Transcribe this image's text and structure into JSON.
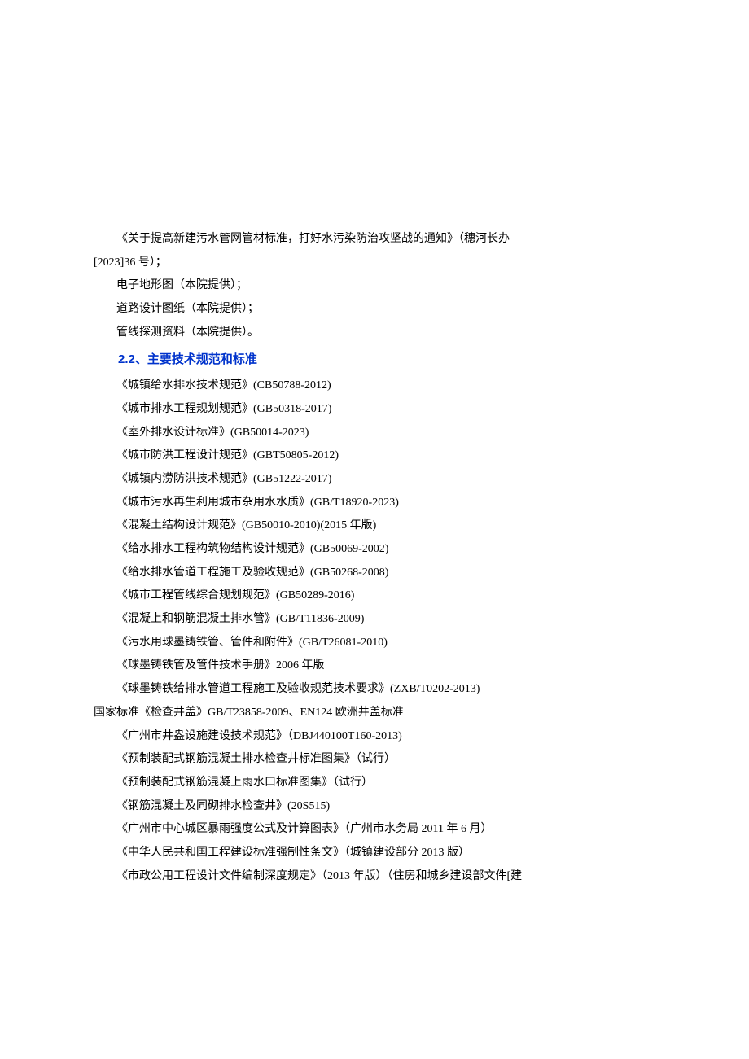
{
  "intro": {
    "line1": "《关于提高新建污水管网管材标准，打好水污染防治攻坚战的通知》（穗河长办",
    "line2": "[2023]36 号）；",
    "line3": "电子地形图（本院提供）；",
    "line4": "道路设计图纸（本院提供）；",
    "line5": "管线探测资料（本院提供）。"
  },
  "heading_2_2": "2.2、主要技术规范和标准",
  "standards": [
    "《城镇给水排水技术规范》(CB50788-2012)",
    "《城市排水工程规划规范》(GB50318-2017)",
    "《室外排水设计标准》(GB50014-2023)",
    "《城市防洪工程设计规范》(GBT50805-2012)",
    "《城镇内涝防洪技术规范》(GB51222-2017)",
    "《城市污水再生利用城市杂用水水质》(GB/T18920-2023)",
    "《混凝土结构设计规范》(GB50010-2010)(2015 年版)",
    "《给水排水工程构筑物结构设计规范》(GB50069-2002)",
    "《给水排水管道工程施工及验收规范》(GB50268-2008)",
    "《城市工程管线综合规划规范》(GB50289-2016)",
    "《混凝上和钢筋混凝土排水管》(GB/T11836-2009)",
    "《污水用球墨铸铁管、管件和附件》(GB/T26081-2010)",
    "《球墨铸铁管及管件技术手册》2006 年版",
    "《球墨铸铁给排水管道工程施工及验收规范技术要求》(ZXB/T0202-2013)"
  ],
  "national_standard": "国家标准《检查井盖》GB/T23858-2009、EN124 欧洲井盖标准",
  "standards2": [
    "《广州市井盎设施建设技术规范》（DBJ440100T160-2013)",
    "《预制装配式钢筋混凝土排水检查井标准图集》（试行）",
    "《预制装配式钢筋混凝上雨水口标准图集》（试行）",
    "《钢筋混凝土及同砌排水检查井》(20S515)",
    "《广州市中心城区暴雨强度公式及计算图表》（广州市水务局 2011 年 6 月）",
    "《中华人民共和国工程建设标准强制性条文》（城镇建设部分 2013 版）",
    "《市政公用工程设计文件编制深度规定》（2013 年版）（住房和城乡建设部文件[建"
  ]
}
